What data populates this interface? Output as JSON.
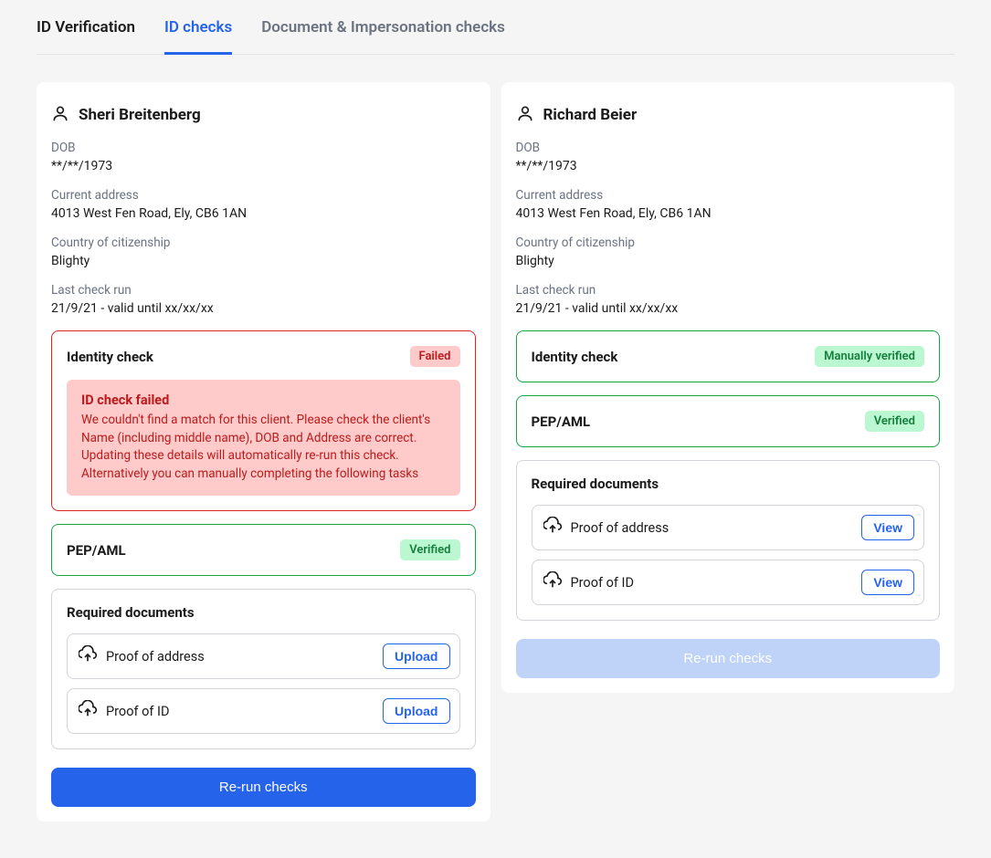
{
  "tabs": [
    {
      "label": "ID Verification",
      "active": false,
      "first": true
    },
    {
      "label": "ID checks",
      "active": true,
      "first": false
    },
    {
      "label": "Document & Impersonation checks",
      "active": false,
      "first": false
    }
  ],
  "labels": {
    "dob": "DOB",
    "address": "Current address",
    "citizenship": "Country of citizenship",
    "lastCheck": "Last check run",
    "identityCheck": "Identity check",
    "pepAml": "PEP/AML",
    "requiredDocs": "Required documents",
    "rerun": "Re-run checks"
  },
  "badges": {
    "failed": "Failed",
    "verified": "Verified",
    "manuallyVerified": "Manually verified"
  },
  "docActions": {
    "upload": "Upload",
    "view": "View"
  },
  "docTypes": {
    "address": "Proof of address",
    "id": "Proof of ID"
  },
  "people": [
    {
      "name": "Sheri Breitenberg",
      "dob": "**/**/1973",
      "address": "4013 West Fen Road, Ely, CB6 1AN",
      "citizenship": "Blighty",
      "lastCheck": "21/9/21 - valid until xx/xx/xx",
      "identityStatus": "failed",
      "identityBadge": "Failed",
      "error": {
        "title": "ID check failed",
        "body": "We couldn't find a match for this client. Please check the client's Name (including middle name), DOB and Address are correct. Updating these details will automatically re-run this check. Alternatively you can manually completing the following tasks"
      },
      "pepStatus": "verified",
      "pepBadge": "Verified",
      "docAction": "Upload",
      "rerunEnabled": true
    },
    {
      "name": "Richard Beier",
      "dob": "**/**/1973",
      "address": "4013 West Fen Road, Ely, CB6 1AN",
      "citizenship": "Blighty",
      "lastCheck": "21/9/21 - valid until xx/xx/xx",
      "identityStatus": "verified",
      "identityBadge": "Manually verified",
      "error": null,
      "pepStatus": "verified",
      "pepBadge": "Verified",
      "docAction": "View",
      "rerunEnabled": false
    }
  ]
}
